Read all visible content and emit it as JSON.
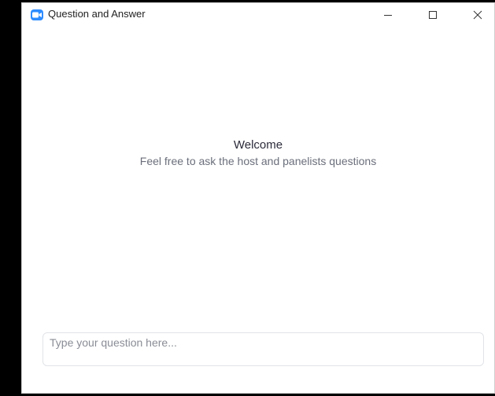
{
  "window": {
    "title": "Question and Answer",
    "app_icon": "zoom-camera-icon",
    "controls": {
      "minimize": "minimize-icon",
      "maximize": "maximize-icon",
      "close": "close-icon"
    }
  },
  "welcome": {
    "title": "Welcome",
    "subtitle": "Feel free to ask the host and panelists questions"
  },
  "question_input": {
    "placeholder": "Type your question here...",
    "value": ""
  },
  "colors": {
    "brand": "#2D8CFF",
    "background": "#FFFFFF",
    "outer": "#000000"
  }
}
